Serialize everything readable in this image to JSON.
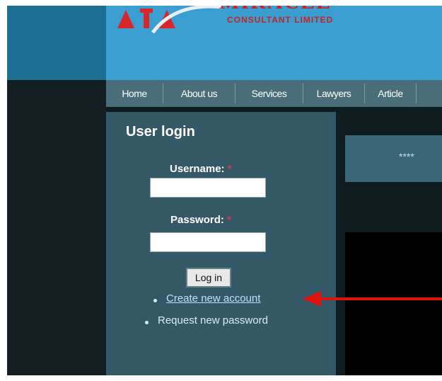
{
  "header": {
    "brand_name": "MIRACLE",
    "brand_subtitle": "CONSULTANT LIMITED"
  },
  "nav": {
    "items": [
      "Home",
      "About us",
      "Services",
      "Lawyers",
      "Article"
    ]
  },
  "login": {
    "title": "User login",
    "username_label": "Username:",
    "password_label": "Password:",
    "required_mark": "*",
    "submit_label": "Log in",
    "links": [
      "Create new account",
      "Request new password"
    ]
  },
  "content": {
    "masked_text": "****"
  },
  "annotation": {
    "arrow_color": "#e0140e",
    "target": "Create new account"
  },
  "colors": {
    "header_blue": "#3a9fd0",
    "nav_bar": "#496e7a",
    "login_panel": "#355867",
    "required_red": "#d7383d",
    "link_color": "#bfe3f5"
  }
}
